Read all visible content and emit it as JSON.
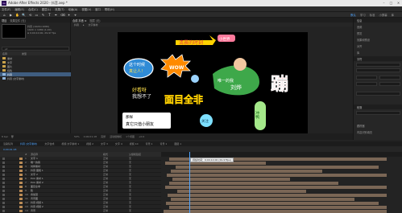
{
  "titlebar": {
    "app_icon": "Ae",
    "title": "Adobe After Effects 2020 - 抖音.aep *",
    "minimize": "–",
    "maximize": "□",
    "close": "✕"
  },
  "menubar": [
    "文件(F)",
    "编辑(E)",
    "合成(C)",
    "图层(L)",
    "效果(T)",
    "动画(A)",
    "视图(V)",
    "窗口",
    "帮助(H)"
  ],
  "toolbar": {
    "tools": [
      "⌂",
      "▶",
      "✋",
      "🔍",
      "⟲",
      "▭",
      "✎",
      "T",
      "✒",
      "⌫",
      "✦",
      "⌖"
    ],
    "workspaces": [
      "默认",
      "学习",
      "标准",
      "小屏幕",
      "库"
    ],
    "active_workspace": "默认"
  },
  "project": {
    "tabs": [
      "项目",
      "效果控件 (无)"
    ],
    "info": [
      "抖音 (1920×1080)",
      "1920 × 1080 (1.00)",
      "Δ 0;00;10;00, 29.97 fps"
    ],
    "search_placeholder": "ρ▾",
    "col_name": "名称",
    "col_type": "类型",
    "rows": [
      {
        "label": "素材",
        "selected": false
      },
      {
        "label": "文字",
        "selected": false
      },
      {
        "label": "图片",
        "selected": false
      },
      {
        "label": "纯色",
        "selected": false
      },
      {
        "label": "抖音",
        "selected": true
      },
      {
        "label": "抖音 (文字素材)",
        "selected": false
      }
    ],
    "footer": [
      "8 bpc",
      "🗑"
    ]
  },
  "composition": {
    "tabs": [
      "合成 抖音 ≡",
      "图层 (无)"
    ],
    "sub": [
      "抖音",
      "▸",
      "文字素材"
    ],
    "footer": [
      "50%",
      "0;00;01;18",
      "完整",
      "活动摄像机",
      "1个视图",
      "+0.0"
    ]
  },
  "canvas": {
    "top_text": "清晨的时刻",
    "top_bubble": "小世界",
    "bubble_left_1": "这个时候",
    "bubble_left_2": "真让人！",
    "burst": "WOW",
    "dialog_1": "好看呀",
    "dialog_2": "我想不了",
    "center_text": "面目全非",
    "speech_bottom_1": "那样",
    "speech_bottom_2": "真它只值小朋友",
    "leaf_label_1": "唯一的我",
    "leaf_label_2": "刘烨",
    "big_char": "蹦",
    "badge": "关注",
    "vertical": "冲鸭"
  },
  "right_panel": {
    "sections": [
      "信息",
      "音频",
      "预览",
      "效果和预设",
      "对齐",
      "库",
      "字符",
      "段落",
      "跟踪器",
      "内容识别填充"
    ],
    "active": "字符"
  },
  "timeline": {
    "tabs": [
      "渲染队列",
      "抖音 (文字素材)",
      "文字合成",
      "视频 文字素材 1",
      "视频 2",
      "文字 3",
      "文字 4",
      "视频 10",
      "背景 1",
      "背景 1",
      "图层 1"
    ],
    "active_tab": "抖音 (文字素材)",
    "timecode": "0;00;01;18",
    "head": {
      "num": "#",
      "name": "源名称",
      "mode": "模式",
      "parent": "父级和链接"
    },
    "rows": [
      {
        "num": "1",
        "name": "文字 1",
        "mode": "正常",
        "parent": "无",
        "color": "#b98a55"
      },
      {
        "num": "2",
        "name": "唯一的我",
        "mode": "正常",
        "parent": "无",
        "color": "#b98a55"
      },
      {
        "num": "3",
        "name": "刘烨素材",
        "mode": "正常",
        "parent": "无",
        "color": "#b98a55"
      },
      {
        "num": "4",
        "name": "抖音 图框 1",
        "mode": "正常",
        "parent": "无",
        "color": "#b98a55"
      },
      {
        "num": "5",
        "name": "文字 2",
        "mode": "正常",
        "parent": "无",
        "color": "#b98a55"
      },
      {
        "num": "6",
        "name": "Pick 素材 1",
        "mode": "正常",
        "parent": "无",
        "color": "#b98a55"
      },
      {
        "num": "7",
        "name": "Pick 素材 2",
        "mode": "正常",
        "parent": "无",
        "color": "#b98a55"
      },
      {
        "num": "8",
        "name": "面目全非",
        "mode": "正常",
        "parent": "无",
        "color": "#b98a55"
      },
      {
        "num": "9",
        "name": "脸",
        "mode": "正常",
        "parent": "无",
        "color": "#b98a55"
      },
      {
        "num": "10",
        "name": "叠加层",
        "mode": "正常",
        "parent": "无",
        "color": "#b98a55"
      },
      {
        "num": "11",
        "name": "背景图",
        "mode": "正常",
        "parent": "无",
        "color": "#b98a55"
      },
      {
        "num": "12",
        "name": "抖音 视频 1",
        "mode": "正常",
        "parent": "无",
        "color": "#b98a55"
      },
      {
        "num": "13",
        "name": "抖音 视频 2",
        "mode": "正常",
        "parent": "无",
        "color": "#b98a55"
      },
      {
        "num": "14",
        "name": "背景",
        "mode": "正常",
        "parent": "无",
        "color": "#b98a55"
      }
    ],
    "tooltip": "持续时间：0;00;10;00 (29.97fps)",
    "bar_color": "#7a6655"
  }
}
